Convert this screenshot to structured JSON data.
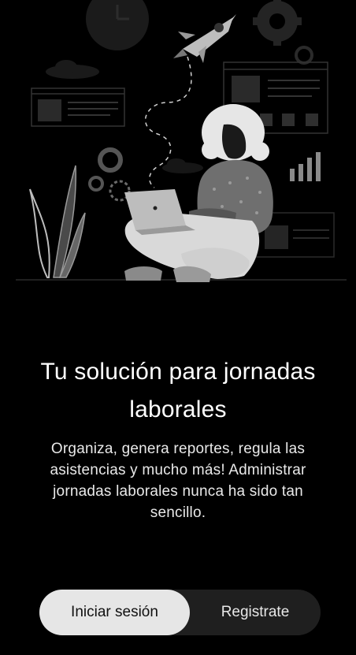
{
  "onboarding": {
    "title": "Tu solución para jornadas laborales",
    "description": "Organiza, genera reportes, regula las asistencias y mucho más! Administrar jornadas laborales nunca ha sido tan sencillo."
  },
  "auth": {
    "login_label": "Iniciar sesión",
    "register_label": "Registrate",
    "selected": "login"
  },
  "colors": {
    "background": "#000000",
    "selected_button": "#e6e6e6",
    "toggle_track": "#1f1f1f"
  },
  "illustration": {
    "subject": "person-with-laptop-illustration"
  }
}
